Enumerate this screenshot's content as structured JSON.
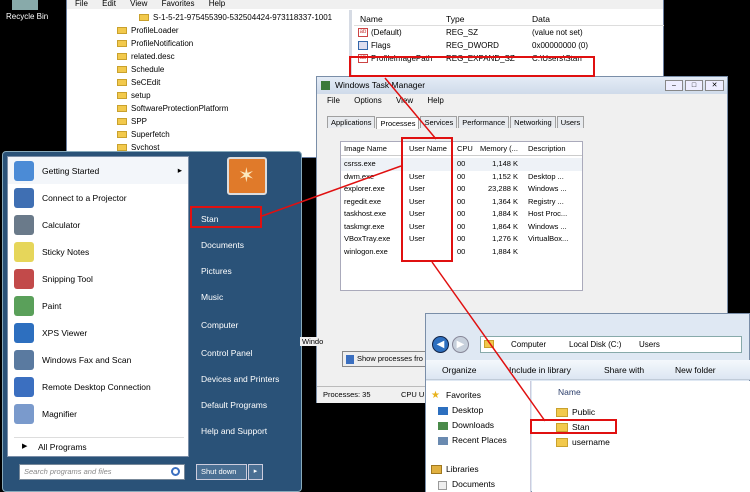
{
  "desktop": {
    "recycle_bin_label": "Recycle Bin"
  },
  "regedit": {
    "menu": [
      "File",
      "Edit",
      "View",
      "Favorites",
      "Help"
    ],
    "tree_items": [
      "S-1-5-21-975455390-532504424-973118337-1001",
      "ProfileLoader",
      "ProfileNotification",
      "related.desc",
      "Schedule",
      "SeCEdit",
      "setup",
      "SoftwareProtectionPlatform",
      "SPP",
      "Superfetch",
      "Svchost"
    ],
    "columns": {
      "name": "Name",
      "type": "Type",
      "data": "Data"
    },
    "values": [
      {
        "name": "(Default)",
        "type": "REG_SZ",
        "data": "(value not set)"
      },
      {
        "name": "Flags",
        "type": "REG_DWORD",
        "data": "0x00000000 (0)"
      },
      {
        "name": "ProfileImagePath",
        "type": "REG_EXPAND_SZ",
        "data": "C:\\Users\\Stan"
      }
    ]
  },
  "taskmgr": {
    "title": "Windows Task Manager",
    "menu": [
      "File",
      "Options",
      "View",
      "Help"
    ],
    "tabs": [
      "Applications",
      "Processes",
      "Services",
      "Performance",
      "Networking",
      "Users"
    ],
    "columns": {
      "image": "Image Name",
      "user": "User Name",
      "cpu": "CPU",
      "mem": "Memory (...",
      "desc": "Description"
    },
    "processes": [
      {
        "image": "csrss.exe",
        "user": "",
        "cpu": "00",
        "mem": "1,148 K",
        "desc": ""
      },
      {
        "image": "dwm.exe",
        "user": "User",
        "cpu": "00",
        "mem": "1,152 K",
        "desc": "Desktop ..."
      },
      {
        "image": "explorer.exe",
        "user": "User",
        "cpu": "00",
        "mem": "23,288 K",
        "desc": "Windows ..."
      },
      {
        "image": "regedit.exe",
        "user": "User",
        "cpu": "00",
        "mem": "1,364 K",
        "desc": "Registry ..."
      },
      {
        "image": "taskhost.exe",
        "user": "User",
        "cpu": "00",
        "mem": "1,884 K",
        "desc": "Host Proc..."
      },
      {
        "image": "taskmgr.exe",
        "user": "User",
        "cpu": "00",
        "mem": "1,864 K",
        "desc": "Windows ..."
      },
      {
        "image": "VBoxTray.exe",
        "user": "User",
        "cpu": "00",
        "mem": "1,276 K",
        "desc": "VirtualBox..."
      },
      {
        "image": "winlogon.exe",
        "user": "",
        "cpu": "00",
        "mem": "1,884 K",
        "desc": ""
      }
    ],
    "show_all_label": "Show processes fro",
    "status_processes": "Processes: 35",
    "status_cpu": "CPU U"
  },
  "startmenu": {
    "left_items": [
      "Getting Started",
      "Connect to a Projector",
      "Calculator",
      "Sticky Notes",
      "Snipping Tool",
      "Paint",
      "XPS Viewer",
      "Windows Fax and Scan",
      "Remote Desktop Connection",
      "Magnifier"
    ],
    "all_programs": "All Programs",
    "search_placeholder": "Search programs and files",
    "right_items": [
      "Stan",
      "Documents",
      "Pictures",
      "Music",
      "Computer",
      "Control Panel",
      "Devices and Printers",
      "Default Programs",
      "Help and Support"
    ],
    "shutdown_label": "Shut down",
    "window_fragment": "Windo"
  },
  "explorer": {
    "breadcrumb": [
      "Computer",
      "Local Disk (C:)",
      "Users"
    ],
    "toolbar": [
      "Organize",
      "Include in library",
      "Share with",
      "New folder"
    ],
    "nav": {
      "favorites": "Favorites",
      "items": [
        "Desktop",
        "Downloads",
        "Recent Places"
      ],
      "libraries": "Libraries",
      "documents": "Documents"
    },
    "column_name": "Name",
    "folders": [
      "Public",
      "Stan",
      "username"
    ]
  },
  "colors": {
    "highlight": "#e01010",
    "startmenu_right": "#1d4a73",
    "folder": "#f2c94c"
  }
}
